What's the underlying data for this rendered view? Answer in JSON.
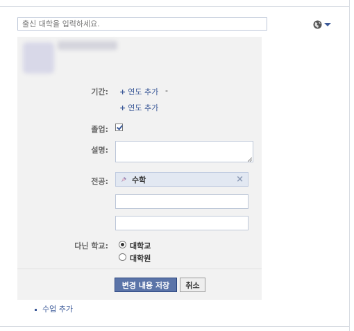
{
  "school_search": {
    "placeholder": "출신 대학을 입력하세요."
  },
  "privacy": {
    "icon": "globe-icon",
    "chevron": "chevron-down-icon"
  },
  "form": {
    "period_label": "기간:",
    "add_year_label_1": "연도 추가",
    "period_dash": "-",
    "add_year_label_2": "연도 추가",
    "graduated_label": "졸업:",
    "graduated_checked": true,
    "description_label": "설명:",
    "description_value": "",
    "major_label": "전공:",
    "major_value": "수학",
    "major_icon": "page-icon",
    "major_remove": "×",
    "extra_major_1": "",
    "extra_major_2": "",
    "attended_label": "다닌 학교:",
    "attended_options": [
      "대학교",
      "대학원"
    ],
    "attended_selected": "대학교",
    "save_label": "변경 내용 저장",
    "cancel_label": "취소"
  },
  "add_course_label": "수업 추가",
  "colors": {
    "link": "#3b5998",
    "panel_bg": "#f2f2f2",
    "save_button_bg": "#5b74a8",
    "major_token_bg": "#e2e8f2"
  }
}
